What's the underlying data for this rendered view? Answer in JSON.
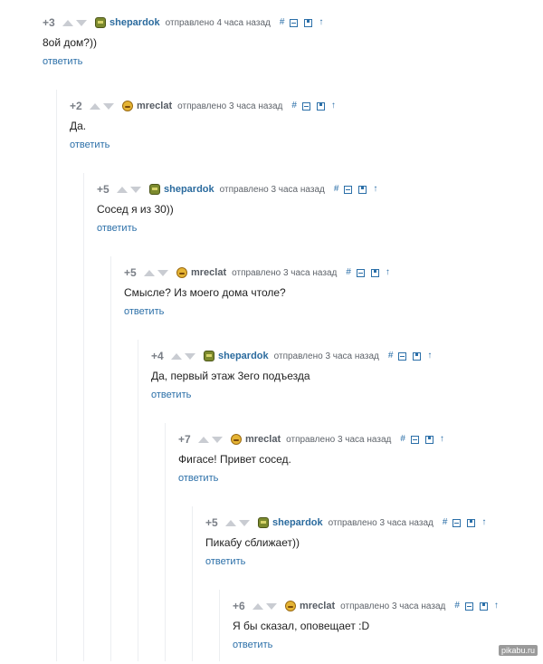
{
  "comments": [
    {
      "rating": "+3",
      "author": "shepardok",
      "avatar": "green-avatar",
      "sent": "отправлено 4 часа назад",
      "text": "8ой дом?))",
      "reply": "ответить"
    },
    {
      "rating": "+2",
      "author": "mreclat",
      "avatar": "yellow-avatar",
      "sent": "отправлено 3 часа назад",
      "text": "Да.",
      "reply": "ответить"
    },
    {
      "rating": "+5",
      "author": "shepardok",
      "avatar": "green-avatar",
      "sent": "отправлено 3 часа назад",
      "text": "Сосед я из 30))",
      "reply": "ответить"
    },
    {
      "rating": "+5",
      "author": "mreclat",
      "avatar": "yellow-avatar",
      "sent": "отправлено 3 часа назад",
      "text": "Смысле? Из моего дома чтоле?",
      "reply": "ответить"
    },
    {
      "rating": "+4",
      "author": "shepardok",
      "avatar": "green-avatar",
      "sent": "отправлено 3 часа назад",
      "text": "Да, первый этаж 3его подъезда",
      "reply": "ответить"
    },
    {
      "rating": "+7",
      "author": "mreclat",
      "avatar": "yellow-avatar",
      "sent": "отправлено 3 часа назад",
      "text": "Фигасе! Привет сосед.",
      "reply": "ответить"
    },
    {
      "rating": "+5",
      "author": "shepardok",
      "avatar": "green-avatar",
      "sent": "отправлено 3 часа назад",
      "text": "Пикабу сближает))",
      "reply": "ответить"
    },
    {
      "rating": "+6",
      "author": "mreclat",
      "avatar": "yellow-avatar",
      "sent": "отправлено 3 часа назад",
      "text": "Я бы сказал, оповещает :D",
      "reply": "ответить"
    }
  ],
  "tool_icons": {
    "permalink": "#",
    "collapse": "collapse-icon",
    "save": "save-icon",
    "parent": "↑"
  },
  "watermark": "pikabu.ru",
  "colors": {
    "author_link": "#2b6b9e",
    "action_link": "#2b6fa8",
    "rating": "#7a7f87"
  }
}
